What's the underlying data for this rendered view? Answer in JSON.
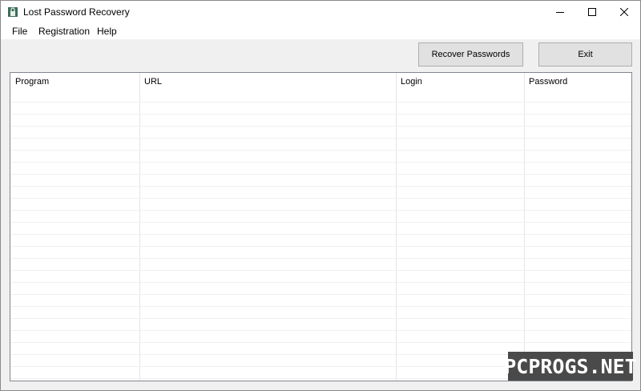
{
  "window": {
    "title": "Lost Password Recovery",
    "app_icon": "lock-app-icon",
    "controls": {
      "minimize_icon": "minimize-icon",
      "maximize_icon": "maximize-icon",
      "close_icon": "close-icon"
    }
  },
  "menu": {
    "items": [
      "File",
      "Registration",
      "Help"
    ]
  },
  "toolbar": {
    "recover_label": "Recover Passwords",
    "exit_label": "Exit"
  },
  "table": {
    "columns": [
      "Program",
      "URL",
      "Login",
      "Password"
    ],
    "rows": []
  },
  "watermark": {
    "text": "PCPROGS.NET"
  },
  "colors": {
    "window_bg": "#f0f0f0",
    "titlebar_bg": "#ffffff",
    "button_bg": "#e1e1e1",
    "watermark_bg": "#4a4a4a"
  }
}
